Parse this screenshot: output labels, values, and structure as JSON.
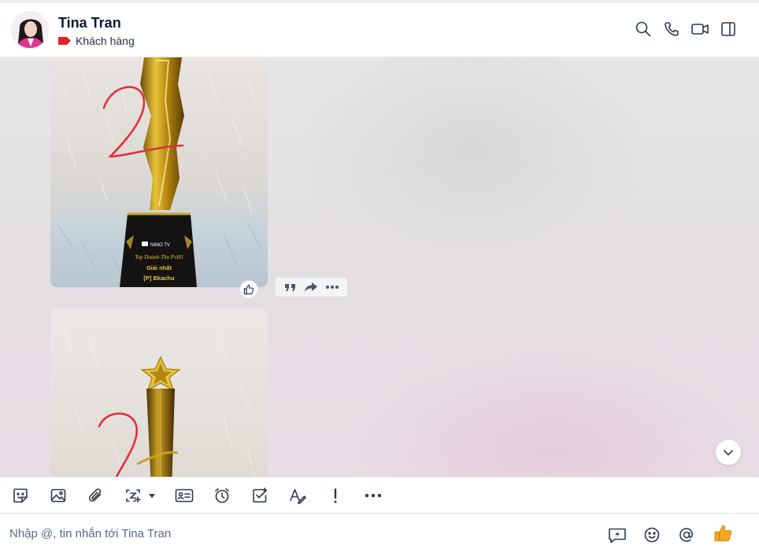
{
  "header": {
    "contact_name": "Tina Tran",
    "tag_label": "Khách hàng",
    "tag_color": "#e02424",
    "icons": [
      "search-icon",
      "phone-icon",
      "video-call-icon",
      "sidebar-toggle-icon"
    ]
  },
  "messages": [
    {
      "type": "image",
      "trophy_plate": {
        "brand": "NIMO TV",
        "line1": "Top Doanh Thu PvH5",
        "line2": "Giải nhất",
        "line3": "[P] Bkachu"
      }
    },
    {
      "type": "image"
    }
  ],
  "message_actions": [
    "quote-icon",
    "forward-icon",
    "more-icon"
  ],
  "toolbar": {
    "icons": [
      "sticker-icon",
      "image-icon",
      "attachment-icon",
      "screenshot-icon",
      "contact-card-icon",
      "reminder-icon",
      "task-icon",
      "text-format-icon",
      "urgent-icon",
      "more-icon"
    ]
  },
  "composer": {
    "placeholder": "Nhập @, tin nhắn tới Tina Tran",
    "icons": [
      "quick-message-icon",
      "emoji-icon",
      "mention-icon",
      "thumbs-up-icon"
    ],
    "accent_color": "#f5a623"
  }
}
